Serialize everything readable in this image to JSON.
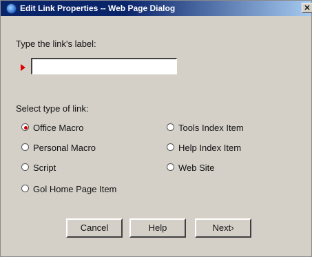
{
  "window": {
    "title": "Edit Link Properties -- Web Page Dialog",
    "close_label": "✕"
  },
  "form": {
    "label_prompt": "Type the link's label:",
    "label_value": "",
    "link_type_prompt": "Select type of link:",
    "options": [
      {
        "label": "Office Macro",
        "selected": true
      },
      {
        "label": "Personal Macro",
        "selected": false
      },
      {
        "label": "Script",
        "selected": false
      },
      {
        "label": "Gol Home Page Item",
        "selected": false
      },
      {
        "label": "Tools Index Item",
        "selected": false
      },
      {
        "label": "Help Index Item",
        "selected": false
      },
      {
        "label": "Web Site",
        "selected": false
      }
    ]
  },
  "buttons": {
    "cancel": "Cancel",
    "help": "Help",
    "next": "Next›"
  },
  "colors": {
    "title_bar": "#0a246a",
    "required_marker": "#e00000",
    "selected_radio": "#d00000"
  }
}
